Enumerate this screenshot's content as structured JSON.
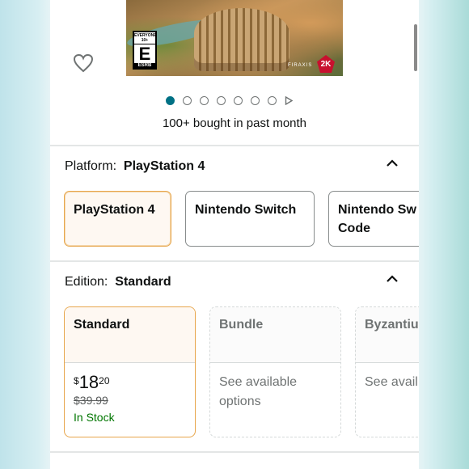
{
  "hero": {
    "image_alt": "Civilization VII game cover",
    "esrb": {
      "top": "EVERYONE 10+",
      "letter": "E",
      "rating_note": "10+",
      "bottom": "ESRB"
    },
    "brand_text": "2K",
    "developer_text": "FIRAXIS",
    "carousel": {
      "total_dots": 7,
      "active_index": 0,
      "has_video": true
    },
    "bought_text": "100+ bought in past month"
  },
  "platform": {
    "label": "Platform:",
    "selected": "PlayStation 4",
    "options": [
      {
        "label": "PlayStation 4",
        "selected": true
      },
      {
        "label": "Nintendo Switch",
        "selected": false
      },
      {
        "label_line1": "Nintendo Sw",
        "label_line2": "Code",
        "selected": false
      }
    ]
  },
  "edition": {
    "label": "Edition:",
    "selected": "Standard",
    "options": [
      {
        "label": "Standard",
        "price_symbol": "$",
        "price_whole": "18",
        "price_fraction": "20",
        "list_price": "$39.99",
        "availability": "In Stock"
      },
      {
        "label": "Bundle",
        "availability_line1": "See available",
        "availability_line2": "options"
      },
      {
        "label": "Byzantiu",
        "availability_line1": "See avail"
      }
    ]
  },
  "colors": {
    "accent_orange": "#e7a64c",
    "in_stock_green": "#007600",
    "dot_active": "#007185"
  }
}
